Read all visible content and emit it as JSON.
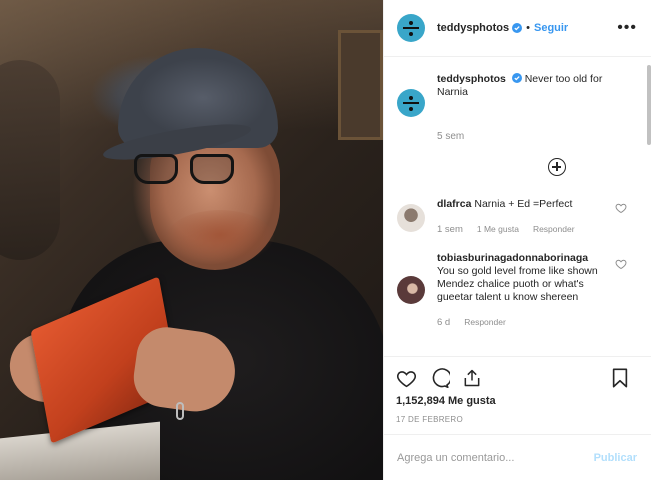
{
  "post": {
    "username": "teddysphotos",
    "follow_label": "Seguir",
    "more_label": "•••",
    "separator": "•",
    "caption_text": "Never too old for Narnia",
    "caption_time": "5 sem"
  },
  "comments": [
    {
      "username": "dlafrca",
      "text": "Narnia + Ed =Perfect",
      "time": "1 sem",
      "likes": "1 Me gusta",
      "reply_label": "Responder",
      "avatar_color": "#cfc8c0"
    },
    {
      "username": "tobiasburinagadonnaborinaga",
      "text": "You so gold level frome like shown Mendez chalice puoth or what's gueetar talent u know shereen",
      "time": "6 d",
      "reply_label": "Responder",
      "avatar_color": "#6a4b4b"
    }
  ],
  "stats": {
    "likes": "1,152,894 Me gusta",
    "date": "17 DE FEBRERO"
  },
  "composer": {
    "placeholder": "Agrega un comentario...",
    "publish_label": "Publicar"
  },
  "icons": {
    "like": "heart-icon",
    "comment": "comment-icon",
    "share": "share-icon",
    "save": "bookmark-icon",
    "verified": "verified-badge-icon",
    "load_more": "plus-circle-icon"
  },
  "colors": {
    "accent": "#3897f0",
    "avatar_brand": "#39a6c9",
    "publish_disabled": "#b2dffc"
  }
}
